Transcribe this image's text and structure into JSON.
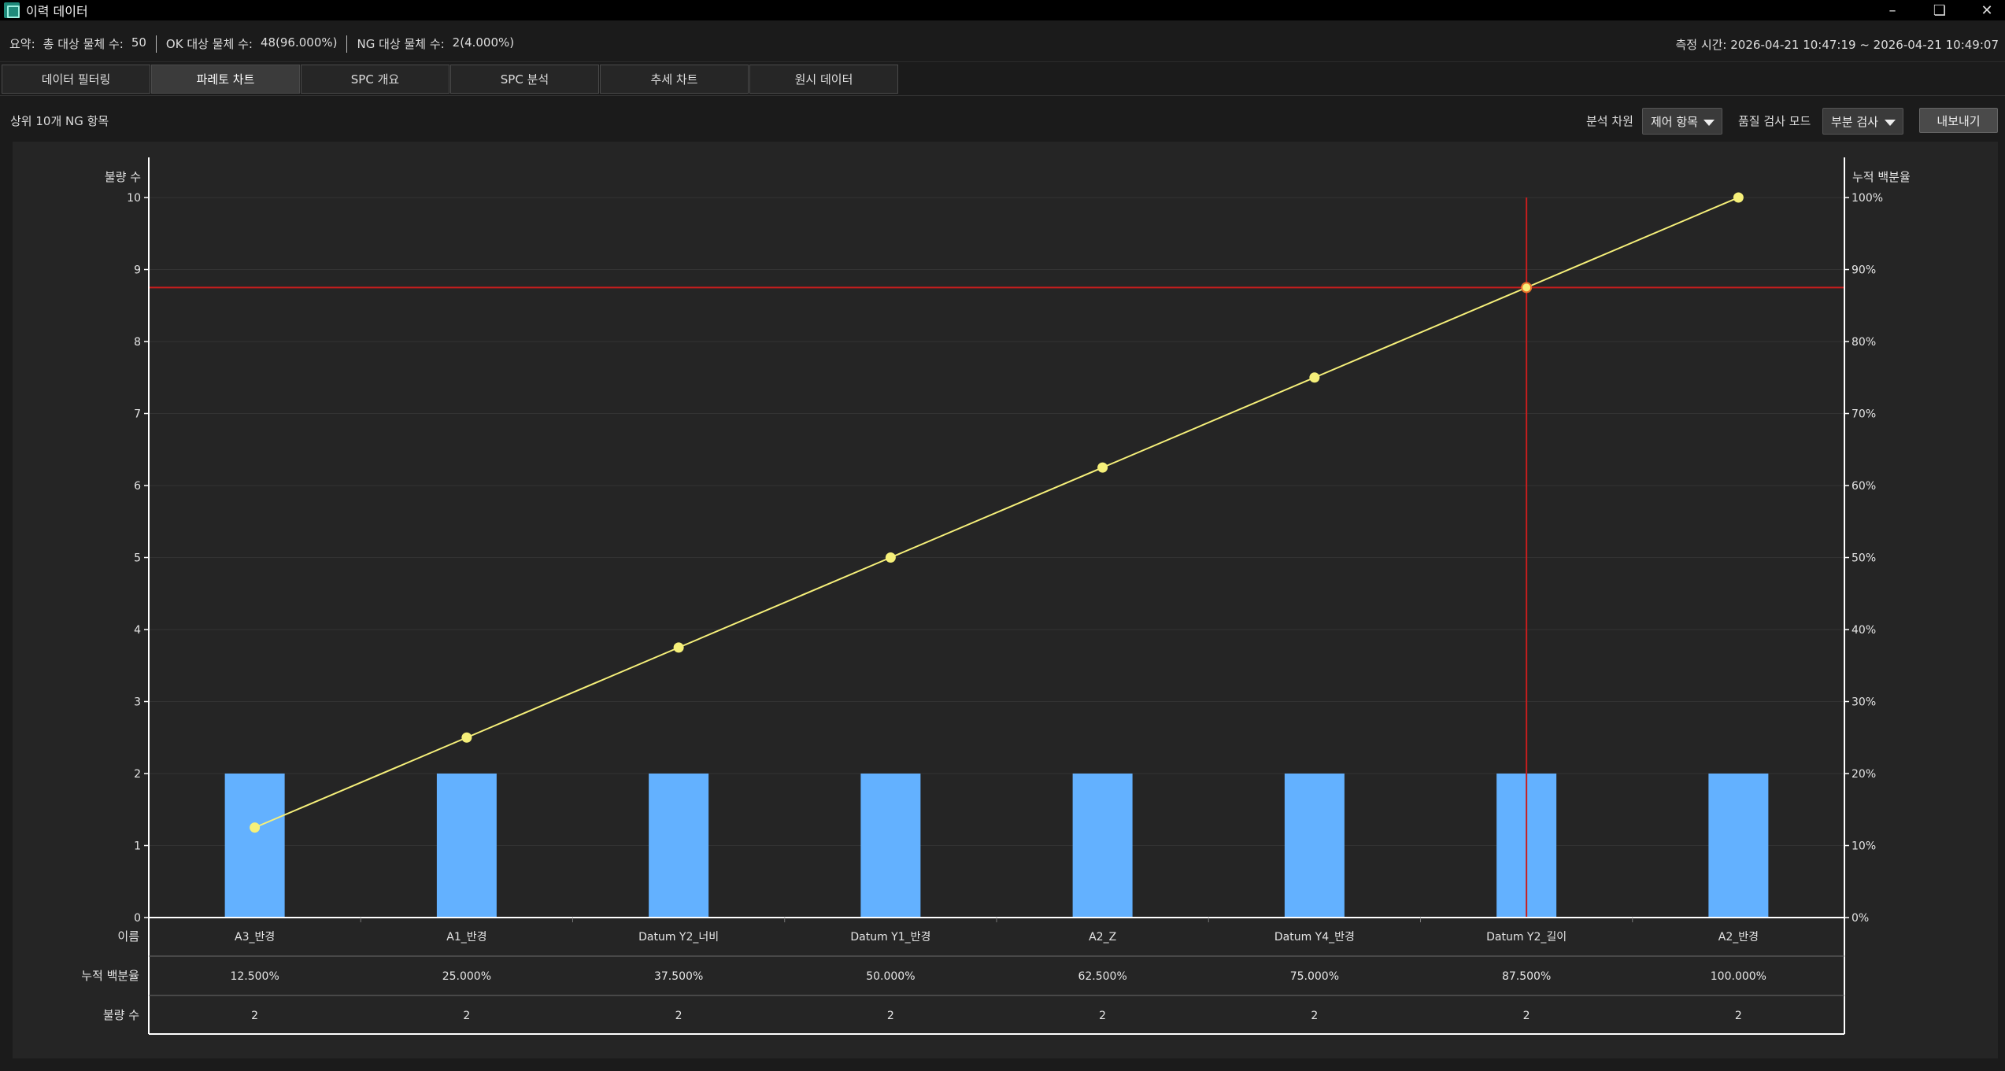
{
  "window": {
    "title": "이력 데이터"
  },
  "summary": {
    "label": "요약:",
    "total_label": "총 대상 물체 수:",
    "total_value": "50",
    "ok_label": "OK 대상 물체 수:",
    "ok_value": "48(96.000%)",
    "ng_label": "NG 대상 물체 수:",
    "ng_value": "2(4.000%)",
    "time_label": "측정 시간:",
    "time_value": "2026-04-21 10:47:19 ~ 2026-04-21 10:49:07"
  },
  "tabs": [
    {
      "label": "데이터 필터링",
      "active": false
    },
    {
      "label": "파레토 차트",
      "active": true
    },
    {
      "label": "SPC 개요",
      "active": false
    },
    {
      "label": "SPC 분석",
      "active": false
    },
    {
      "label": "추세 차트",
      "active": false
    },
    {
      "label": "원시 데이터",
      "active": false
    }
  ],
  "toolbar": {
    "section_title": "상위 10개 NG 항목",
    "dimension_label": "분석 차원",
    "dimension_value": "제어 항목",
    "mode_label": "품질 검사 모드",
    "mode_value": "부분 검사",
    "export_label": "내보내기"
  },
  "chart_data": {
    "type": "bar",
    "combo": "pareto (bar + cumulative line)",
    "ylabel": "불량 수",
    "y2label": "누적 백분율",
    "ylim": [
      0,
      10
    ],
    "y2lim": [
      0,
      100
    ],
    "y_ticks": [
      "0",
      "1",
      "2",
      "3",
      "4",
      "5",
      "6",
      "7",
      "8",
      "9",
      "10"
    ],
    "y2_ticks": [
      "0%",
      "10%",
      "20%",
      "30%",
      "40%",
      "50%",
      "60%",
      "70%",
      "80%",
      "90%",
      "100%"
    ],
    "categories": [
      "A3_반경",
      "A1_반경",
      "Datum Y2_너비",
      "Datum Y1_반경",
      "A2_Z",
      "Datum Y4_반경",
      "Datum Y2_길이",
      "A2_반경"
    ],
    "series": [
      {
        "values": [
          2,
          2,
          2,
          2,
          2,
          2,
          2,
          2
        ]
      },
      {
        "values": [
          12.5,
          25,
          37.5,
          50,
          62.5,
          75,
          87.5,
          100
        ]
      }
    ],
    "table_row_labels": [
      "이름",
      "누적 백분율",
      "불량 수"
    ],
    "cumulative_labels": [
      "12.500%",
      "25.000%",
      "37.500%",
      "50.000%",
      "62.500%",
      "75.000%",
      "87.500%",
      "100.000%"
    ],
    "count_labels": [
      "2",
      "2",
      "2",
      "2",
      "2",
      "2",
      "2",
      "2"
    ],
    "crosshair": {
      "category_index": 6,
      "percent": 87.5
    },
    "colors": {
      "bar": "#63b1ff",
      "line": "#f6f07a",
      "crosshair": "#c81e1e",
      "background": "#252525",
      "grid": "#333333"
    },
    "grid": true
  }
}
